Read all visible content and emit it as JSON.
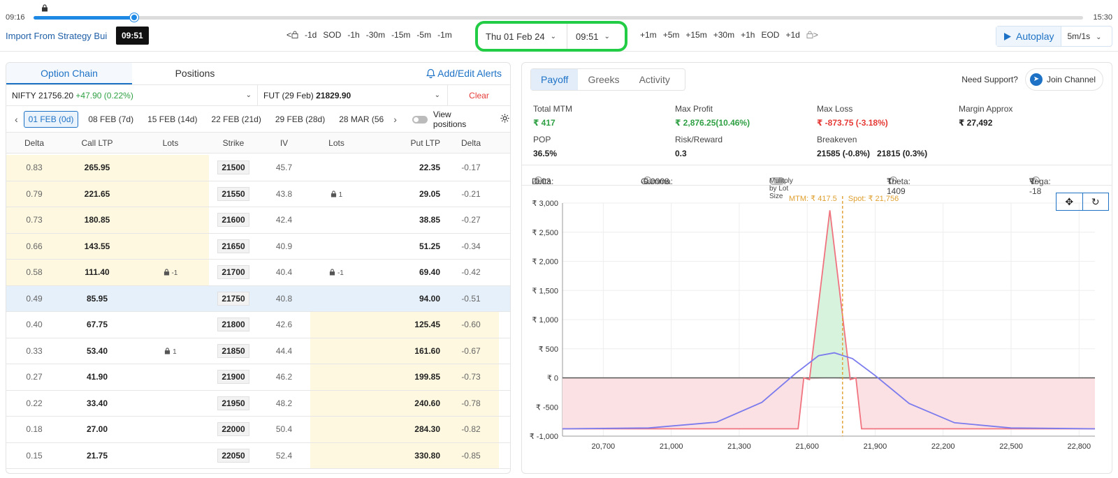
{
  "timeline": {
    "start_time": "09:16",
    "end_time": "15:30",
    "current_time_tooltip": "09:51",
    "progress": 0.096
  },
  "import_link": "Import From Strategy Bui",
  "step_back": [
    "<",
    "-1d",
    "SOD",
    "-1h",
    "-30m",
    "-15m",
    "-5m",
    "-1m"
  ],
  "step_forward": [
    "+1m",
    "+5m",
    "+15m",
    "+30m",
    "+1h",
    "EOD",
    "+1d",
    ">"
  ],
  "date_picker": {
    "date": "Thu 01 Feb 24",
    "time": "09:51"
  },
  "autoplay": {
    "label": "Autoplay",
    "speed": "5m/1s"
  },
  "left_panel": {
    "tabs": [
      "Option Chain",
      "Positions"
    ],
    "alerts_label": "Add/Edit Alerts",
    "underlying": {
      "name": "NIFTY",
      "price": "21756.20",
      "change": "+47.90 (0.22%)"
    },
    "future": {
      "name": "FUT (29 Feb)",
      "price": "21829.90"
    },
    "clear_label": "Clear",
    "expiries": [
      "01 FEB (0d)",
      "08 FEB (7d)",
      "15 FEB (14d)",
      "22 FEB (21d)",
      "29 FEB (28d)",
      "28 MAR (56"
    ],
    "view_positions_label": "View positions",
    "columns": [
      "Delta",
      "Call LTP",
      "Lots",
      "Strike",
      "IV",
      "Lots",
      "Put LTP",
      "Delta"
    ],
    "rows": [
      {
        "cdelta": "0.83",
        "call": "265.95",
        "clots": "",
        "strike": "21500",
        "iv": "45.7",
        "plots": "",
        "put": "22.35",
        "pdelta": "-0.17",
        "zone": "itm-call"
      },
      {
        "cdelta": "0.79",
        "call": "221.65",
        "clots": "",
        "strike": "21550",
        "iv": "43.8",
        "plots": "1",
        "put": "29.05",
        "pdelta": "-0.21",
        "zone": "itm-call"
      },
      {
        "cdelta": "0.73",
        "call": "180.85",
        "clots": "",
        "strike": "21600",
        "iv": "42.4",
        "plots": "",
        "put": "38.85",
        "pdelta": "-0.27",
        "zone": "itm-call"
      },
      {
        "cdelta": "0.66",
        "call": "143.55",
        "clots": "",
        "strike": "21650",
        "iv": "40.9",
        "plots": "",
        "put": "51.25",
        "pdelta": "-0.34",
        "zone": "itm-call"
      },
      {
        "cdelta": "0.58",
        "call": "111.40",
        "clots": "-1",
        "strike": "21700",
        "iv": "40.4",
        "plots": "-1",
        "put": "69.40",
        "pdelta": "-0.42",
        "zone": "itm-call"
      },
      {
        "cdelta": "0.49",
        "call": "85.95",
        "clots": "",
        "strike": "21750",
        "iv": "40.8",
        "plots": "",
        "put": "94.00",
        "pdelta": "-0.51",
        "zone": "atm"
      },
      {
        "cdelta": "0.40",
        "call": "67.75",
        "clots": "",
        "strike": "21800",
        "iv": "42.6",
        "plots": "",
        "put": "125.45",
        "pdelta": "-0.60",
        "zone": "itm-put"
      },
      {
        "cdelta": "0.33",
        "call": "53.40",
        "clots": "1",
        "strike": "21850",
        "iv": "44.4",
        "plots": "",
        "put": "161.60",
        "pdelta": "-0.67",
        "zone": "itm-put"
      },
      {
        "cdelta": "0.27",
        "call": "41.90",
        "clots": "",
        "strike": "21900",
        "iv": "46.2",
        "plots": "",
        "put": "199.85",
        "pdelta": "-0.73",
        "zone": "itm-put"
      },
      {
        "cdelta": "0.22",
        "call": "33.40",
        "clots": "",
        "strike": "21950",
        "iv": "48.2",
        "plots": "",
        "put": "240.60",
        "pdelta": "-0.78",
        "zone": "itm-put"
      },
      {
        "cdelta": "0.18",
        "call": "27.00",
        "clots": "",
        "strike": "22000",
        "iv": "50.4",
        "plots": "",
        "put": "284.30",
        "pdelta": "-0.82",
        "zone": "itm-put"
      },
      {
        "cdelta": "0.15",
        "call": "21.75",
        "clots": "",
        "strike": "22050",
        "iv": "52.4",
        "plots": "",
        "put": "330.80",
        "pdelta": "-0.85",
        "zone": "itm-put"
      }
    ]
  },
  "right_panel": {
    "tabs": [
      "Payoff",
      "Greeks",
      "Activity"
    ],
    "support_label": "Need Support?",
    "join_label": "Join Channel",
    "stats": {
      "total_mtm": {
        "label": "Total MTM",
        "value": "₹ 417"
      },
      "max_profit": {
        "label": "Max Profit",
        "value": "₹ 2,876.25(10.46%)"
      },
      "max_loss": {
        "label": "Max Loss",
        "value": "₹ -873.75 (-3.18%)"
      },
      "margin": {
        "label": "Margin Approx",
        "value": "₹ 27,492"
      },
      "pop": {
        "label": "POP",
        "value": "36.5%"
      },
      "risk_reward": {
        "label": "Risk/Reward",
        "value": "0.3"
      },
      "breakeven": {
        "label": "Breakeven",
        "value": "21585 (-0.8%)   21815 (0.3%)"
      }
    },
    "greeks": {
      "delta": "Delta:",
      "delta_val": "-0.03",
      "gamma": "Gamma:",
      "gamma_val": "-0.0008",
      "multiply": "Mulitply by Lot Size",
      "theta": "Theta:",
      "theta_val": "₹ 1409",
      "vega": "Vega:",
      "vega_val": "₹ -18"
    },
    "colors": {
      "profit_fill": "#d7f2dd",
      "loss_fill": "#fbe1e3",
      "expiry_line": "#f0737f",
      "target_line": "#7b7bee",
      "spot_line": "#e0a030"
    }
  },
  "chart_data": {
    "type": "line",
    "mtm_label": "MTM: ₹ 417.5",
    "spot_label": "Spot: ₹ 21,756",
    "spot": 21756,
    "xlim": [
      20520,
      22870
    ],
    "ylim": [
      -1000,
      3000
    ],
    "x_ticks": [
      20700,
      21000,
      21300,
      21600,
      21900,
      22200,
      22500,
      22800
    ],
    "x_tick_labels": [
      "20,700",
      "21,000",
      "21,300",
      "21,600",
      "21,900",
      "22,200",
      "22,500",
      "22,800"
    ],
    "y_ticks": [
      3000,
      2500,
      2000,
      1500,
      1000,
      500,
      0,
      -500,
      -1000
    ],
    "y_tick_labels": [
      "₹ 3,000",
      "₹ 2,500",
      "₹ 2,000",
      "₹ 1,500",
      "₹ 1,000",
      "₹ 500",
      "₹ 0",
      "₹ -500",
      "₹ -1,000"
    ],
    "series": [
      {
        "values_x": [
          20520,
          21560,
          21585,
          21610,
          21700,
          21790,
          21815,
          21840,
          22870
        ],
        "values_y": [
          -874,
          -874,
          0,
          -30,
          2876,
          -30,
          0,
          -874,
          -874
        ]
      },
      {
        "values_x": [
          20520,
          20900,
          21200,
          21400,
          21550,
          21650,
          21720,
          21800,
          21900,
          22050,
          22250,
          22500,
          22870
        ],
        "values_y": [
          -874,
          -860,
          -760,
          -420,
          80,
          380,
          430,
          330,
          40,
          -440,
          -770,
          -860,
          -874
        ]
      }
    ]
  }
}
